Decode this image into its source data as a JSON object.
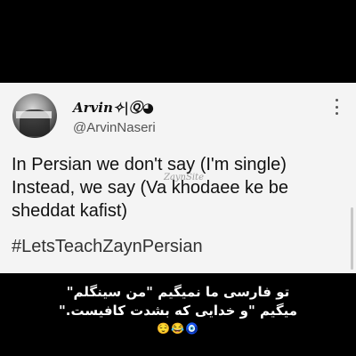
{
  "tweet": {
    "display_name": "Arvin✧|Ⓠ◕",
    "handle": "@ArvinNaseri",
    "lines": [
      "In Persian we don't say (I'm single)",
      "Instead, we say (Va khodaee ke be",
      "sheddat kafist)"
    ],
    "hashtag": "#LetsTeachZaynPersian",
    "watermark": "ZaynSite",
    "more_icon": "more-vertical-icon",
    "avatar_icon": "profile-photo"
  },
  "caption": {
    "lines": [
      "تو فارسی ما نمیگیم \"من سینگلم\"",
      "میگیم \"و خدایی که بشدت کافیست.\""
    ],
    "emojis": "😌😂🧿"
  }
}
